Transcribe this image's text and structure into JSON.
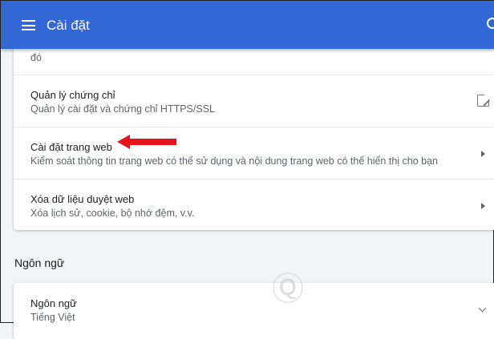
{
  "header": {
    "title": "Cài đặt"
  },
  "privacy": {
    "continuation": "đó",
    "items": [
      {
        "title": "Quản lý chứng chỉ",
        "subtitle": "Quản lý cài đặt và chứng chỉ HTTPS/SSL",
        "icon": "external-link-icon"
      },
      {
        "title": "Cài đặt trang web",
        "subtitle": "Kiểm soát thông tin trang web có thể sử dụng và nội dung trang web có thể hiển thị cho bạn",
        "icon": "arrow-right-icon"
      },
      {
        "title": "Xóa dữ liệu duyệt web",
        "subtitle": "Xóa lịch sử, cookie, bộ nhớ đệm, v.v.",
        "icon": "arrow-right-icon"
      }
    ]
  },
  "language": {
    "section_title": "Ngôn ngữ",
    "item_title": "Ngôn ngữ",
    "item_value": "Tiếng Việt"
  },
  "watermark": "Quantrimang",
  "annotation_color": "#e8141b"
}
